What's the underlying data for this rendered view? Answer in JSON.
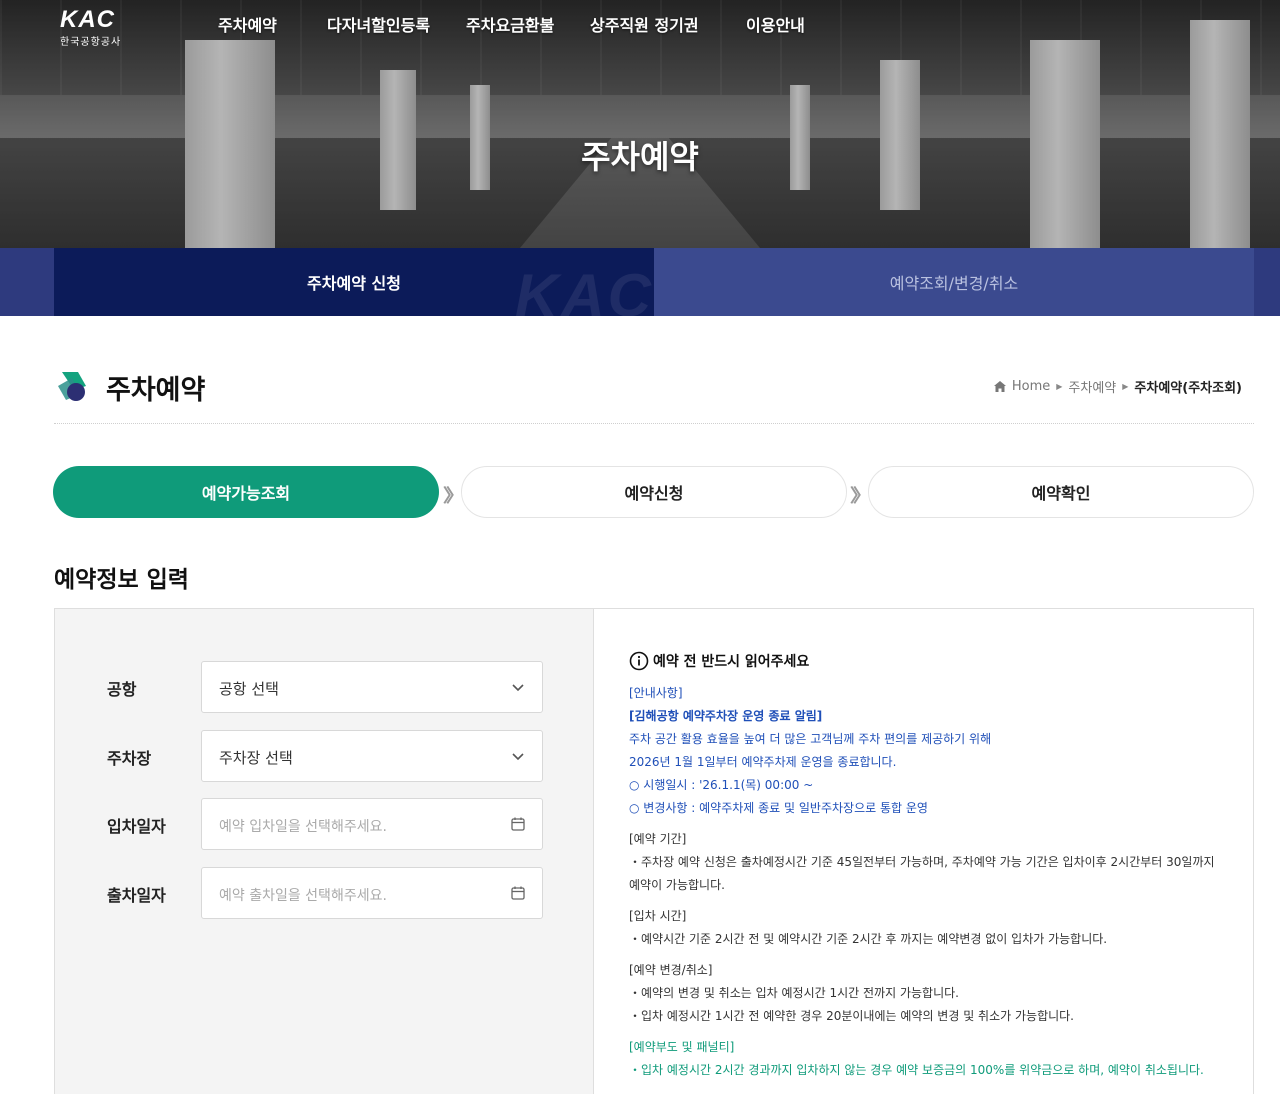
{
  "header": {
    "logo_mark": "KAC",
    "logo_sub": "한국공항공사",
    "nav": [
      "주차예약",
      "다자녀할인등록",
      "주차요금환불",
      "상주직원 정기권",
      "이용안내"
    ],
    "hero_title": "주차예약"
  },
  "subnav": {
    "active": "주차예약 신청",
    "inactive": "예약조회/변경/취소",
    "watermark": "KAC"
  },
  "page": {
    "title": "주차예약",
    "breadcrumb": [
      "Home",
      "주차예약",
      "주차예약(주차조회)"
    ]
  },
  "steps": [
    "예약가능조회",
    "예약신청",
    "예약확인"
  ],
  "section_title": "예약정보 입력",
  "form": {
    "airport_label": "공항",
    "airport_value": "공항 선택",
    "lot_label": "주차장",
    "lot_value": "주차장 선택",
    "entry_label": "입차일자",
    "entry_placeholder": "예약 입차일을 선택해주세요.",
    "exit_label": "출차일자",
    "exit_placeholder": "예약 출차일을 선택해주세요."
  },
  "notice": {
    "heading": "예약 전 반드시 읽어주세요",
    "guide_tag": "[안내사항]",
    "gimhae_title": "[김해공항 예약주차장 운영 종료 알림]",
    "gimhae_line1": "주차 공간 활용 효율을 높여 더 많은 고객님께 주차 편의를 제공하기 위해",
    "gimhae_line2": "2026년 1월 1일부터 예약주차제 운영을 종료합니다.",
    "gimhae_line3": "○ 시행일시 : '26.1.1(목) 00:00 ~",
    "gimhae_line4": "○ 변경사항 : 예약주차제 종료 및 일반주차장으로 통합 운영",
    "period_tag": "[예약 기간]",
    "period_line1": "・주차장 예약 신청은 출차예정시간 기준 45일전부터 가능하며, 주차예약 가능 기간은 입차이후 2시간부터 30일까지",
    "period_line2": "예약이 가능합니다.",
    "entry_tag": "[입차 시간]",
    "entry_line1": "・예약시간 기준 2시간 전 및 예약시간 기준 2시간 후 까지는 예약변경 없이 입차가 가능합니다.",
    "change_tag": "[예약 변경/취소]",
    "change_line1": "・예약의 변경 및 취소는 입차 예정시간 1시간 전까지 가능합니다.",
    "change_line2": "・입차 예정시간 1시간 전 예약한 경우 20분이내에는 예약의 변경 및 취소가 가능합니다.",
    "penalty_tag": "[예약부도 및 패널티]",
    "penalty_line1": "・입차 예정시간 2시간 경과까지 입차하지 않는 경우 예약 보증금의 100%를 위약금으로 하며, 예약이 취소됩니다."
  },
  "colors": {
    "navy_active": "#0c1b59",
    "navy_bar": "#3b4a8f",
    "accent_green": "#0f9b7a",
    "notice_blue": "#1f4fb8"
  },
  "icons": [
    "home-icon",
    "chevron-down-icon",
    "calendar-icon",
    "info-icon",
    "double-chevron-icon"
  ]
}
